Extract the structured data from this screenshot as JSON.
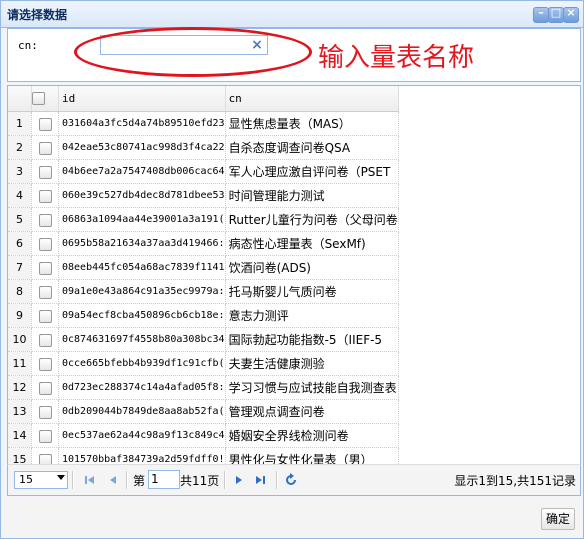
{
  "dialog": {
    "title": "请选择数据",
    "buttons": {
      "minimize": "–",
      "maximize": "□",
      "close": "×"
    }
  },
  "search": {
    "label": "cn:",
    "value": "",
    "clear_glyph": "×",
    "annotation": "输入量表名称",
    "annotation_color": "#e3171e"
  },
  "grid": {
    "columns": {
      "id": "id",
      "cn": "cn"
    },
    "rows": [
      {
        "num": "1",
        "id": "031604a3fc5d4a74b89510efd23",
        "cn": "显性焦虑量表（MAS）"
      },
      {
        "num": "2",
        "id": "042eae53c80741ac998d3f4ca22",
        "cn": "自杀态度调查问卷QSA"
      },
      {
        "num": "3",
        "id": "04b6ee7a2a7547408db006cac64",
        "cn": "军人心理应激自评问卷（PSET"
      },
      {
        "num": "4",
        "id": "060e39c527db4dec8d781dbee53",
        "cn": "时间管理能力测试"
      },
      {
        "num": "5",
        "id": "06863a1094aa44e39001a3a191(",
        "cn": "Rutter儿童行为问卷（父母问卷"
      },
      {
        "num": "6",
        "id": "0695b58a21634a37aa3d419466:",
        "cn": "病态性心理量表（SexMf)"
      },
      {
        "num": "7",
        "id": "08eeb445fc054a68ac7839f1141",
        "cn": "饮酒问卷(ADS)"
      },
      {
        "num": "8",
        "id": "09a1e0e43a864c91a35ec9979a:",
        "cn": "托马斯婴儿气质问卷"
      },
      {
        "num": "9",
        "id": "09a54ecf8cba450896cb6cb18e:",
        "cn": "意志力测评"
      },
      {
        "num": "10",
        "id": "0c874631697f4558b80a308bc34",
        "cn": "国际勃起功能指数-5（IIEF-5"
      },
      {
        "num": "11",
        "id": "0cce665bfebb4b939df1c91cfb(",
        "cn": "夫妻生活健康测验"
      },
      {
        "num": "12",
        "id": "0d723ec288374c14a4afad05f8:",
        "cn": "学习习惯与应试技能自我测查表"
      },
      {
        "num": "13",
        "id": "0db209044b7849de8aa8ab52fa(",
        "cn": "管理观点调查问卷"
      },
      {
        "num": "14",
        "id": "0ec537ae62a44c98a9f13c849c4",
        "cn": "婚姻安全界线检测问卷"
      },
      {
        "num": "15",
        "id": "101570bbaf384739a2d59fdff0!",
        "cn": "男性化与女性化量表（男）"
      }
    ]
  },
  "pager": {
    "page_size": "15",
    "page_prefix": "第",
    "current_page": "1",
    "page_suffix": "共11页",
    "info": "显示1到15,共151记录"
  },
  "footer": {
    "ok_label": "确定"
  },
  "colors": {
    "accent": "#95b8e7",
    "icon_blue": "#4d79b5",
    "annotation": "#e3171e"
  }
}
